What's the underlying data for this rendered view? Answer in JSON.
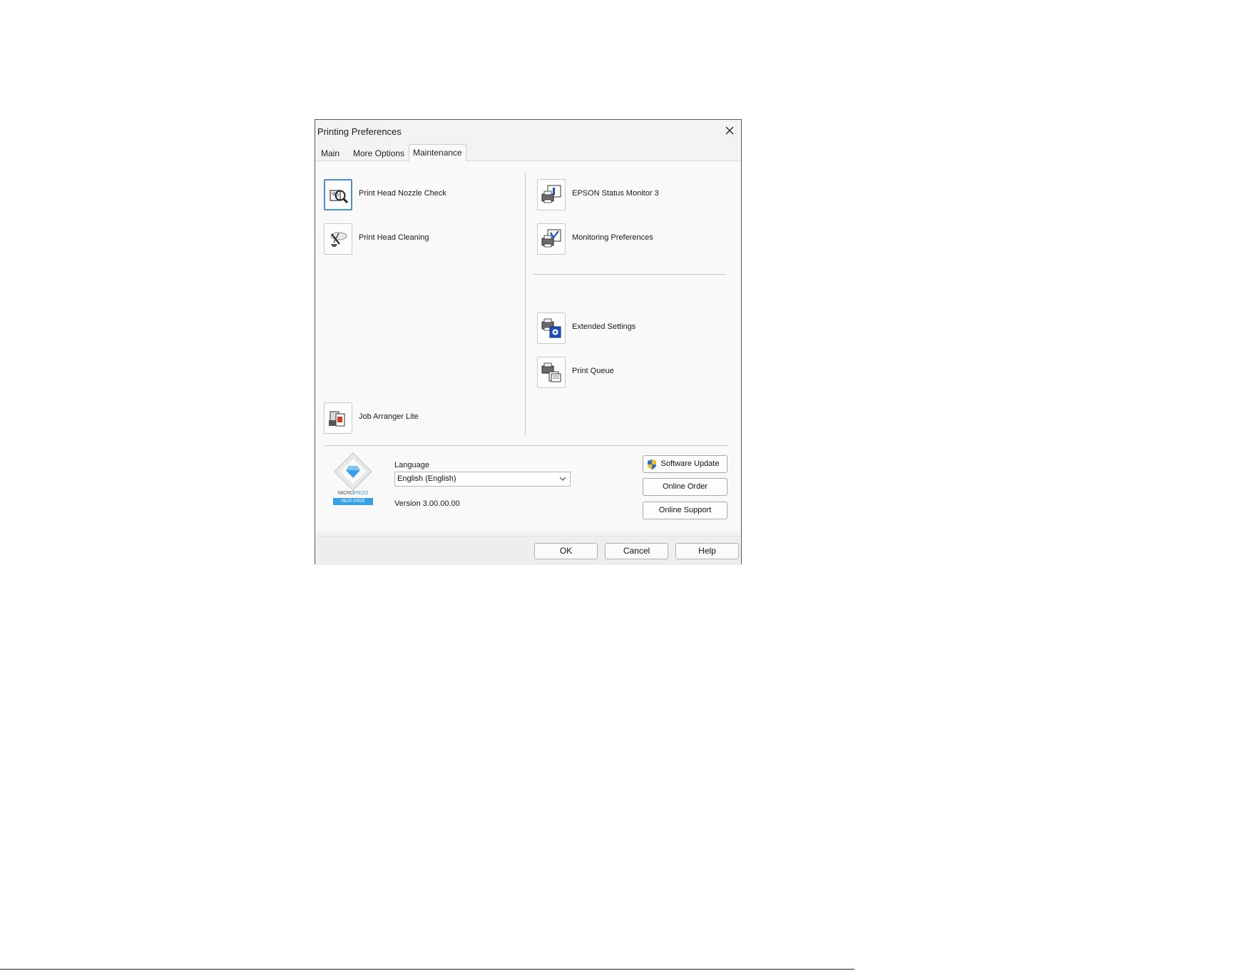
{
  "window": {
    "title": "Printing Preferences"
  },
  "tabs": [
    {
      "label": "Main",
      "active": false
    },
    {
      "label": "More Options",
      "active": false
    },
    {
      "label": "Maintenance",
      "active": true
    }
  ],
  "maintenance": {
    "left_items": [
      {
        "label": "Print Head Nozzle Check",
        "icon": "nozzle-check-icon"
      },
      {
        "label": "Print Head Cleaning",
        "icon": "head-cleaning-icon"
      },
      {
        "label": "Job Arranger Lite",
        "icon": "job-arranger-icon"
      }
    ],
    "right_items": [
      {
        "label": "EPSON Status Monitor 3",
        "icon": "status-monitor-icon"
      },
      {
        "label": "Monitoring Preferences",
        "icon": "monitoring-preferences-icon"
      },
      {
        "label": "Extended Settings",
        "icon": "extended-settings-icon"
      },
      {
        "label": "Print Queue",
        "icon": "print-queue-icon"
      }
    ]
  },
  "logo": {
    "line1_a": "MICRO",
    "line1_b": "PIEZO",
    "line2": "HEAT-FREE"
  },
  "language": {
    "label": "Language",
    "value": "English (English)"
  },
  "version": "Version 3.00.00.00",
  "side_buttons": {
    "software_update": "Software Update",
    "online_order": "Online Order",
    "online_support": "Online Support"
  },
  "footer": {
    "ok": "OK",
    "cancel": "Cancel",
    "help": "Help"
  },
  "colors": {
    "accent": "#4a8fd9",
    "logo_blue": "#3aa0e6",
    "shield_blue": "#2f6fd6",
    "shield_yellow": "#f2c21b"
  }
}
